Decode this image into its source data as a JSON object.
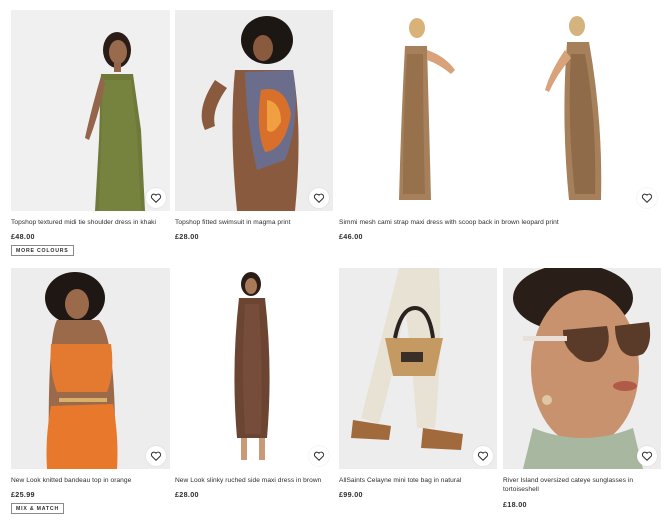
{
  "products": [
    {
      "title": "Topshop textured midi tie shoulder dress in khaki",
      "price": "£48.00",
      "tag": "MORE COLOURS"
    },
    {
      "title": "Topshop fitted swimsuit in magma print",
      "price": "£28.00"
    },
    {
      "title": "Simmi mesh cami strap maxi dress with scoop back in brown leopard print",
      "price": "£46.00"
    },
    {
      "title": "New Look knitted bandeau top in orange",
      "price": "£25.99",
      "tag": "MIX & MATCH"
    },
    {
      "title": "New Look slinky ruched side maxi dress in brown",
      "price": "£28.00"
    },
    {
      "title": "AllSaints Celayne mini tote bag in natural",
      "price": "£99.00"
    },
    {
      "title": "River Island oversized cateye sunglasses in tortoiseshell",
      "price": "£18.00"
    }
  ],
  "icons": {
    "save": "heart-icon"
  }
}
